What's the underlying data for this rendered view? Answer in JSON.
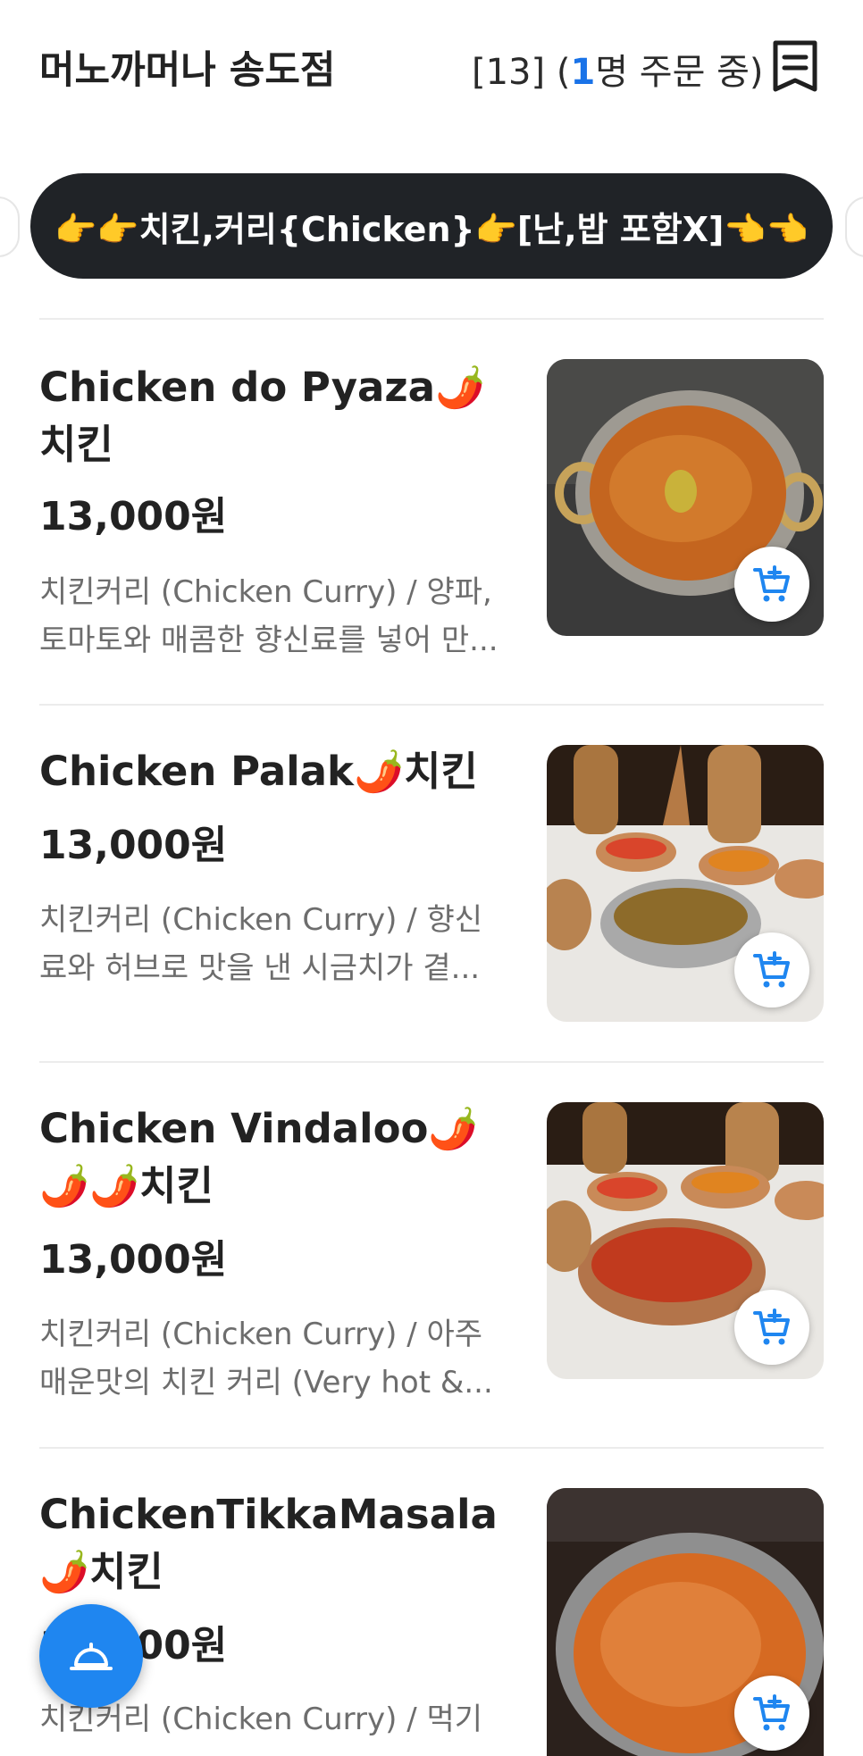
{
  "header": {
    "store_name": "머노까머나 송도점",
    "order_prefix": "[13] (",
    "order_count": "1",
    "order_suffix": "명 주문 중)",
    "receipt_icon": "receipt-icon"
  },
  "category": {
    "label": "👉👉치킨,커리{Chicken}👉[난,밥 포함X]👈👈"
  },
  "menu": {
    "items": [
      {
        "name": "Chicken do Pyaza🌶️치킨",
        "price": "13,000원",
        "desc": "치킨커리 (Chicken Curry) / 양파, 토마토와 매콤한 향신료를 넣어 만...",
        "image_icon": "curry-bowl-image"
      },
      {
        "name": "Chicken Palak🌶️치킨",
        "price": "13,000원",
        "desc": "치킨커리 (Chicken Curry) / 향신료와 허브로 맛을 낸 시금치가 곁...",
        "image_icon": "curry-bowl-image"
      },
      {
        "name": "Chicken Vindaloo🌶️🌶️🌶️치킨",
        "price": "13,000원",
        "desc": "치킨커리 (Chicken Curry) / 아주 매운맛의 치킨 커리 (Very hot &...",
        "image_icon": "curry-bowl-image"
      },
      {
        "name": "ChickenTikkaMasala🌶️치킨",
        "price": "13,000원",
        "desc": "치킨커리 (Chicken Curry) / 먹기",
        "image_icon": "curry-bowl-image"
      }
    ]
  },
  "colors": {
    "accent": "#1f86f0",
    "pill": "#202327",
    "desc_text": "#6d6d6d"
  }
}
